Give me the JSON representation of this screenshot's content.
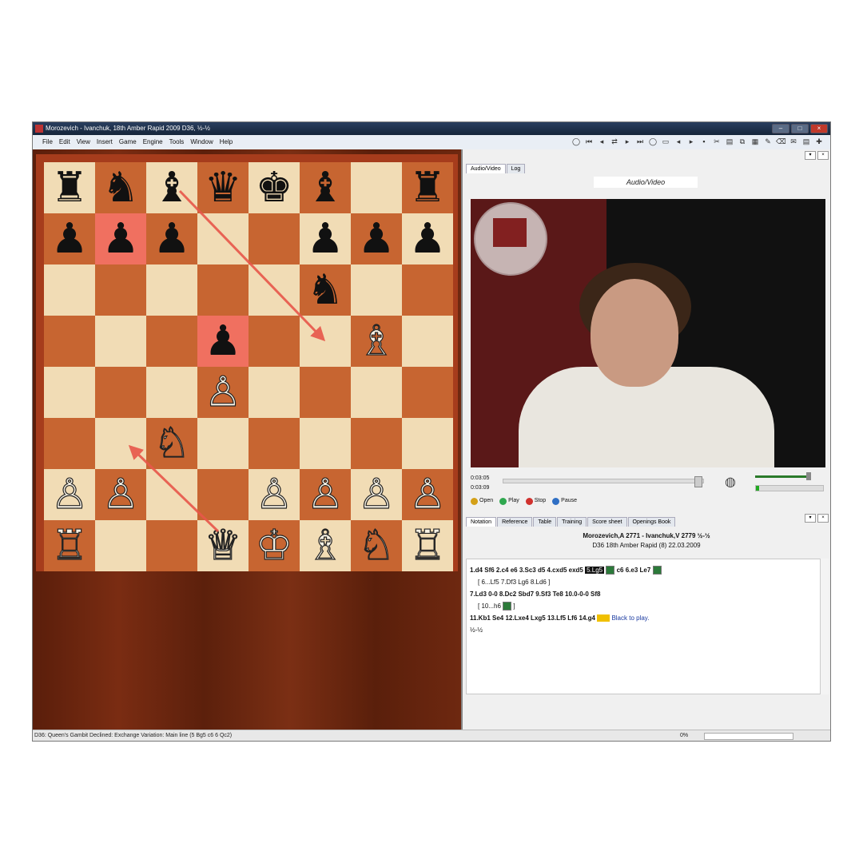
{
  "window": {
    "title": "Morozevich - Ivanchuk, 18th Amber Rapid 2009  D36, ½-½",
    "minimize": "–",
    "maximize": "□",
    "close": "×"
  },
  "menu": [
    "File",
    "Edit",
    "View",
    "Insert",
    "Game",
    "Engine",
    "Tools",
    "Window",
    "Help"
  ],
  "toolbar_icons": [
    "new-icon",
    "first-move-icon",
    "back-icon",
    "flip-icon",
    "forward-icon",
    "last-move-icon",
    "stop-icon",
    "doc-icon",
    "left-icon",
    "right-icon",
    "save-icon",
    "cut-icon",
    "print-icon",
    "copy-icon",
    "paste-icon",
    "edit-icon",
    "erase-icon",
    "mail-icon",
    "pdf-icon",
    "add-icon"
  ],
  "board": {
    "rows": [
      [
        "♜",
        "♞",
        "♝",
        "♛",
        "♚",
        "♝",
        "",
        "♜"
      ],
      [
        "♟",
        "♟",
        "♟",
        "",
        "",
        "♟",
        "♟",
        "♟"
      ],
      [
        "",
        "",
        "",
        "",
        "",
        "♞",
        "",
        ""
      ],
      [
        "",
        "",
        "",
        "♟",
        "",
        "",
        "♗",
        ""
      ],
      [
        "",
        "",
        "",
        "♙",
        "",
        "",
        "",
        ""
      ],
      [
        "",
        "",
        "♘",
        "",
        "",
        "",
        "",
        ""
      ],
      [
        "♙",
        "♙",
        "",
        "",
        "♙",
        "♙",
        "♙",
        "♙"
      ],
      [
        "♖",
        "",
        "",
        "♕",
        "♔",
        "♗",
        "♘",
        "♖"
      ]
    ],
    "highlight": [
      [
        1,
        1
      ],
      [
        3,
        3
      ]
    ],
    "arrow_color": "#e8574a"
  },
  "audio_video": {
    "tabs": [
      "Audio/Video",
      "Log"
    ],
    "header": "Audio/Video",
    "time_current": "0:03:05",
    "time_total": "0:03:09",
    "seek_fraction": 0.97,
    "volume_fraction": 0.8,
    "buttons": [
      "Open",
      "Play",
      "Stop",
      "Pause"
    ],
    "button_colors": [
      "#d4a017",
      "#2fa84f",
      "#d0312d",
      "#2f6fc4"
    ]
  },
  "notation": {
    "tabs": [
      "Notation",
      "Reference",
      "Table",
      "Training",
      "Score sheet",
      "Openings Book"
    ],
    "players": "Morozevich,A 2771 - Ivanchuk,V 2779  ½-½",
    "event": "D36 18th Amber Rapid (8) 22.03.2009",
    "line1": "1.d4 Sf6 2.c4 e6 3.Sc3 d5 4.cxd5 exd5",
    "current_move": "5.Lg5",
    "line1_end": "c6 6.e3 Le7",
    "variation1": "[ 6...Lf5 7.Df3 Lg6 8.Ld6 ]",
    "line2": "7.Ld3 0-0 8.Dc2 Sbd7 9.Sf3 Te8 10.0-0-0 Sf8",
    "variation2": "[ 10...h6",
    "variation2_end": "]",
    "line3": "11.Kb1 Se4 12.Lxe4 Lxg5 13.Lf5 Lf6 14.g4",
    "to_play": "Black to play.",
    "result": "½-½"
  },
  "status": {
    "opening": "D36: Queen's Gambit Declined: Exchange Variation: Main line (5 Bg5 c6 6 Qc2)",
    "percent": "0%"
  }
}
